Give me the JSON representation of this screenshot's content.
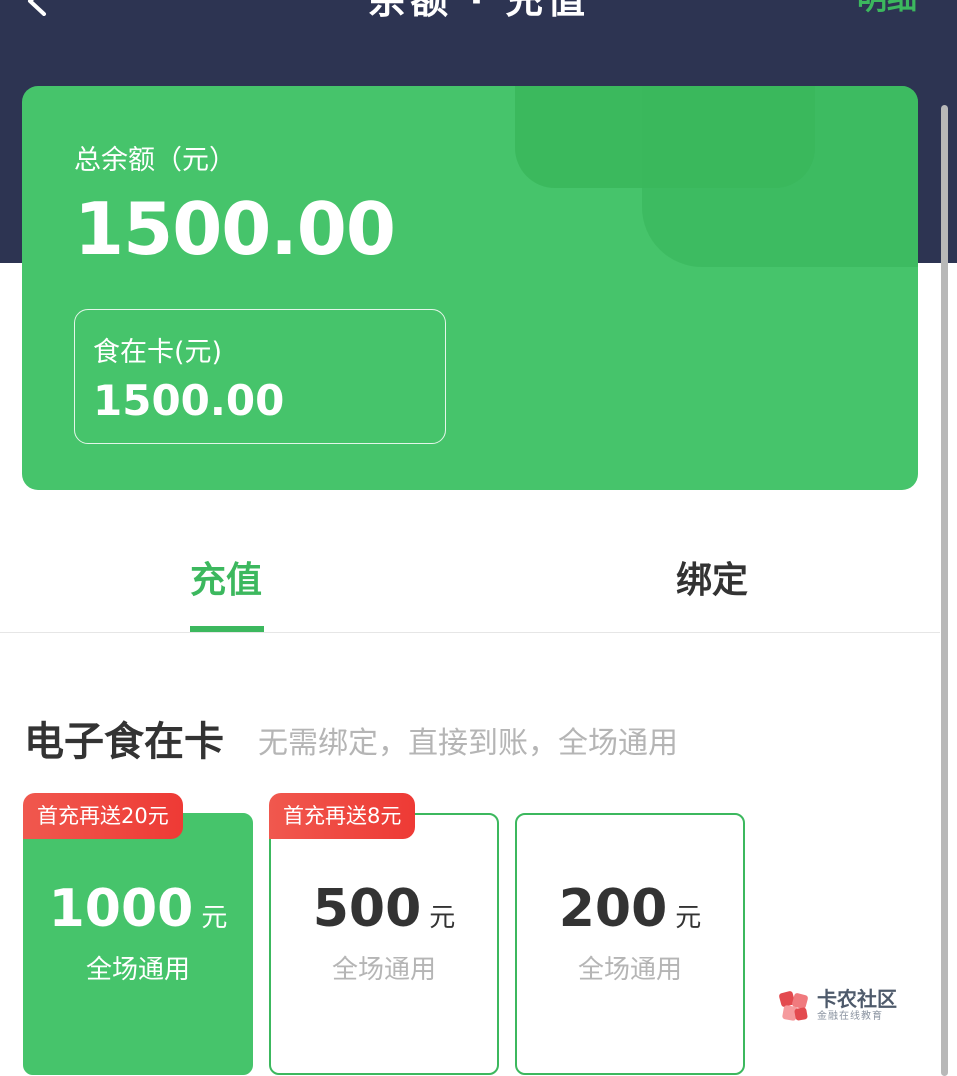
{
  "nav": {
    "title": "余额 · 充值",
    "detail_label": "明细"
  },
  "balance": {
    "total_label": "总余额（元）",
    "total_amount": "1500.00",
    "card_label": "食在卡(元)",
    "card_amount": "1500.00"
  },
  "tabs": [
    {
      "label": "充值",
      "active": true
    },
    {
      "label": "绑定",
      "active": false
    }
  ],
  "section": {
    "title": "电子食在卡",
    "subtitle": "无需绑定，直接到账，全场通用"
  },
  "options": [
    {
      "amount": "1000",
      "unit": "元",
      "desc": "全场通用",
      "promo": "首充再送20元",
      "selected": true
    },
    {
      "amount": "500",
      "unit": "元",
      "desc": "全场通用",
      "promo": "首充再送8元",
      "selected": false
    },
    {
      "amount": "200",
      "unit": "元",
      "desc": "全场通用",
      "promo": "",
      "selected": false
    }
  ],
  "watermark": {
    "name": "卡农社区",
    "sub": "金融在线教育"
  },
  "colors": {
    "header_bg": "#2d3452",
    "brand_green": "#46c46b",
    "accent_green": "#3cb85e",
    "promo_red": "#ee3a35"
  },
  "icons": {
    "back": "chevron-left-icon",
    "watermark": "watermark-logo-icon"
  }
}
